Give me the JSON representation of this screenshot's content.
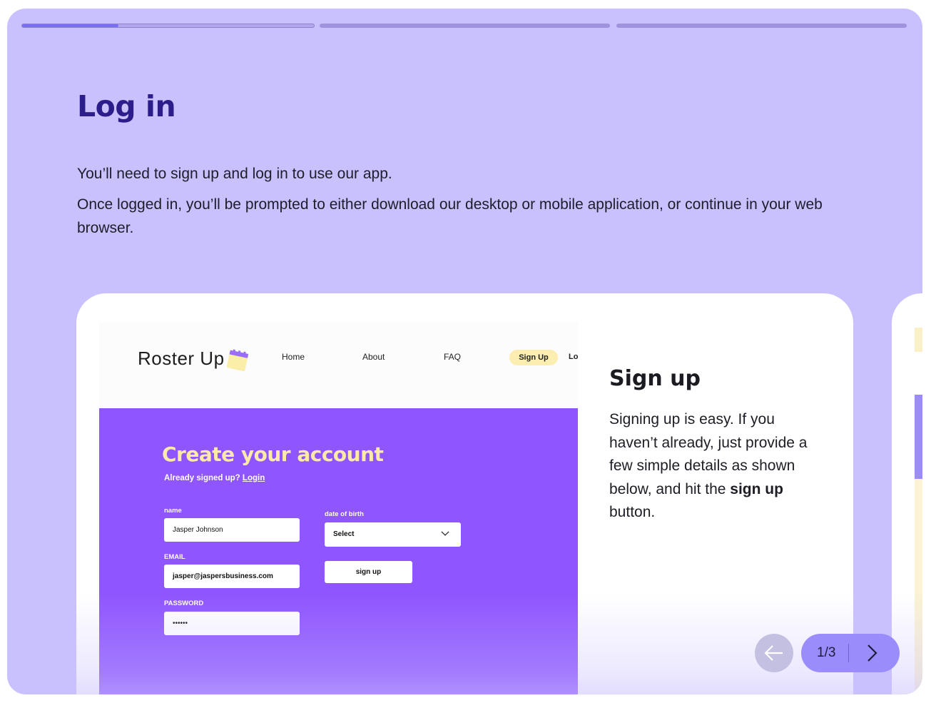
{
  "progress": {
    "segments": [
      {
        "label": "step-1",
        "filled": 0.33,
        "active": true
      },
      {
        "label": "step-2",
        "filled": 0,
        "active": false
      },
      {
        "label": "step-3",
        "filled": 0,
        "active": false
      }
    ]
  },
  "header": {
    "title": "Log in",
    "paragraph_1": "You’ll need to sign up and log in to use our app.",
    "paragraph_2": "Once logged in, you’ll be prompted to either download our desktop or mobile application, or continue in your web browser."
  },
  "slide": {
    "screenshot": {
      "brand": "Roster Up",
      "nav": [
        "Home",
        "About",
        "FAQ"
      ],
      "nav_signup": "Sign Up",
      "nav_login_cut": "Log",
      "form_title": "Create your account",
      "already_text": "Already signed up?",
      "login_link": "Login",
      "fields": {
        "name_label": "name",
        "name_value": "Jasper Johnson",
        "email_label": "EMAIL",
        "email_value": "jasper@jaspersbusiness.com",
        "password_label": "PASSWORD",
        "password_value": "••••••",
        "dob_label": "date of birth",
        "dob_value": "Select",
        "submit_label": "sign up"
      }
    },
    "heading": "Sign up",
    "body_before": "Signing up is easy. If you haven’t already, just provide a few simple details as shown below, and hit the ",
    "body_bold": "sign up",
    "body_after": " button."
  },
  "carousel": {
    "counter": "1/3",
    "prev_icon": "arrow-left-icon",
    "next_icon": "chevron-right-icon"
  },
  "colors": {
    "background": "#c9c1fd",
    "title": "#2c1e8a",
    "form_bg": "#8f55fe",
    "form_title": "#fde9a8",
    "pager": "#9a8dfb"
  }
}
